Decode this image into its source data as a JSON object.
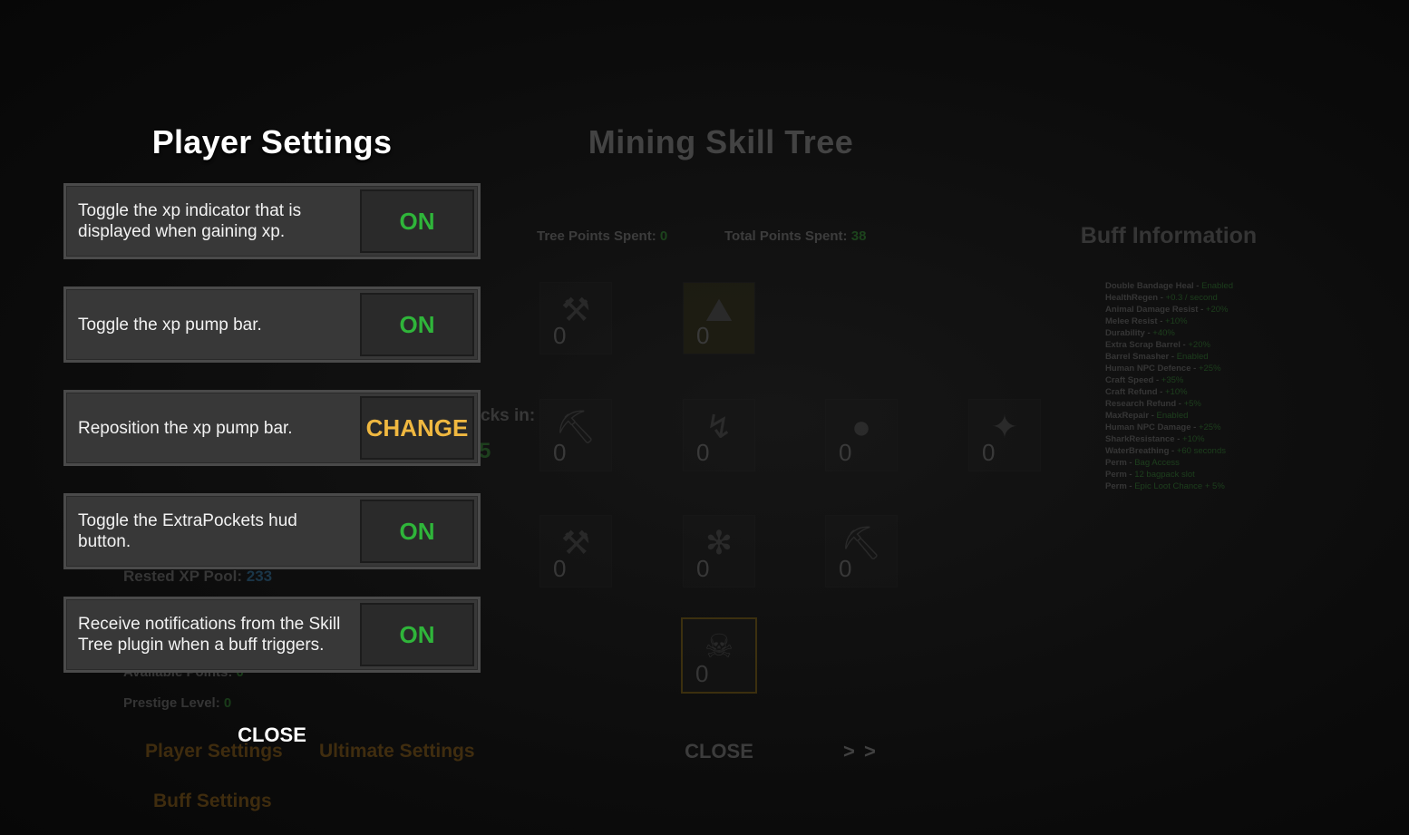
{
  "player_settings": {
    "title": "Player Settings",
    "rows": [
      {
        "label": "Toggle the xp indicator that is displayed when gaining xp.",
        "button": "ON"
      },
      {
        "label": "Toggle the xp pump bar.",
        "button": "ON"
      },
      {
        "label": "Reposition the xp pump bar.",
        "button": "CHANGE"
      },
      {
        "label": "Toggle the ExtraPockets hud button.",
        "button": "ON"
      },
      {
        "label": "Receive notifications from the Skill Tree plugin when a buff triggers.",
        "button": "ON"
      }
    ],
    "close_label": "CLOSE"
  },
  "skill_tree": {
    "title": "Mining Skill Tree",
    "tree_points_label": "Tree Points Spent:",
    "tree_points_value": "0",
    "total_points_label": "Total Points Spent:",
    "total_points_value": "38",
    "partial_text": "cks in:",
    "partial_value": "5",
    "slots": [
      {
        "value": "0",
        "icon": "hammer-icon"
      },
      {
        "value": "0",
        "icon": "ore-field-icon"
      },
      {
        "value": "0",
        "icon": "anvil-icon"
      },
      {
        "value": "0",
        "icon": "spark-icon"
      },
      {
        "value": "0",
        "icon": "cauldron-icon"
      },
      {
        "value": "0",
        "icon": "crack-icon"
      },
      {
        "value": "0",
        "icon": "sledgehammer-icon"
      },
      {
        "value": "0",
        "icon": "fire-icon"
      },
      {
        "value": "0",
        "icon": "pickaxe-icon"
      },
      {
        "value": "0",
        "icon": "ultimate-icon"
      }
    ],
    "close_label": "CLOSE",
    "next_label": "> >"
  },
  "stats": {
    "rested_label": "Rested XP Pool:",
    "rested_value": "233",
    "available_label": "Available Points:",
    "available_value": "0",
    "prestige_label": "Prestige Level:",
    "prestige_value": "0"
  },
  "nav": {
    "player_settings": "Player Settings",
    "ultimate_settings": "Ultimate Settings",
    "buff_settings": "Buff Settings"
  },
  "buffs": {
    "title": "Buff Information",
    "items": [
      {
        "name": "Double Bandage Heal",
        "value": "Enabled"
      },
      {
        "name": "HealthRegen",
        "value": "+0.3 / second"
      },
      {
        "name": "Animal Damage Resist",
        "value": "+20%"
      },
      {
        "name": "Melee Resist",
        "value": "+10%"
      },
      {
        "name": "Durability",
        "value": "+40%"
      },
      {
        "name": "Extra Scrap Barrel",
        "value": "+20%"
      },
      {
        "name": "Barrel Smasher",
        "value": "Enabled"
      },
      {
        "name": "Human NPC Defence",
        "value": "+25%"
      },
      {
        "name": "Craft Speed",
        "value": "+35%"
      },
      {
        "name": "Craft Refund",
        "value": "+10%"
      },
      {
        "name": "Research Refund",
        "value": "+5%"
      },
      {
        "name": "MaxRepair",
        "value": "Enabled"
      },
      {
        "name": "Human NPC Damage",
        "value": "+25%"
      },
      {
        "name": "SharkResistance",
        "value": "+10%"
      },
      {
        "name": "WaterBreathing",
        "value": "+60 seconds"
      },
      {
        "name": "Perm",
        "value": "Bag Access"
      },
      {
        "name": "Perm",
        "value": "12 bagpack slot"
      },
      {
        "name": "Perm",
        "value": "Epic Loot Chance + 5%"
      }
    ]
  },
  "colors": {
    "on": "#2fb53a",
    "change": "#f0b840",
    "nav": "#8a5d16"
  }
}
